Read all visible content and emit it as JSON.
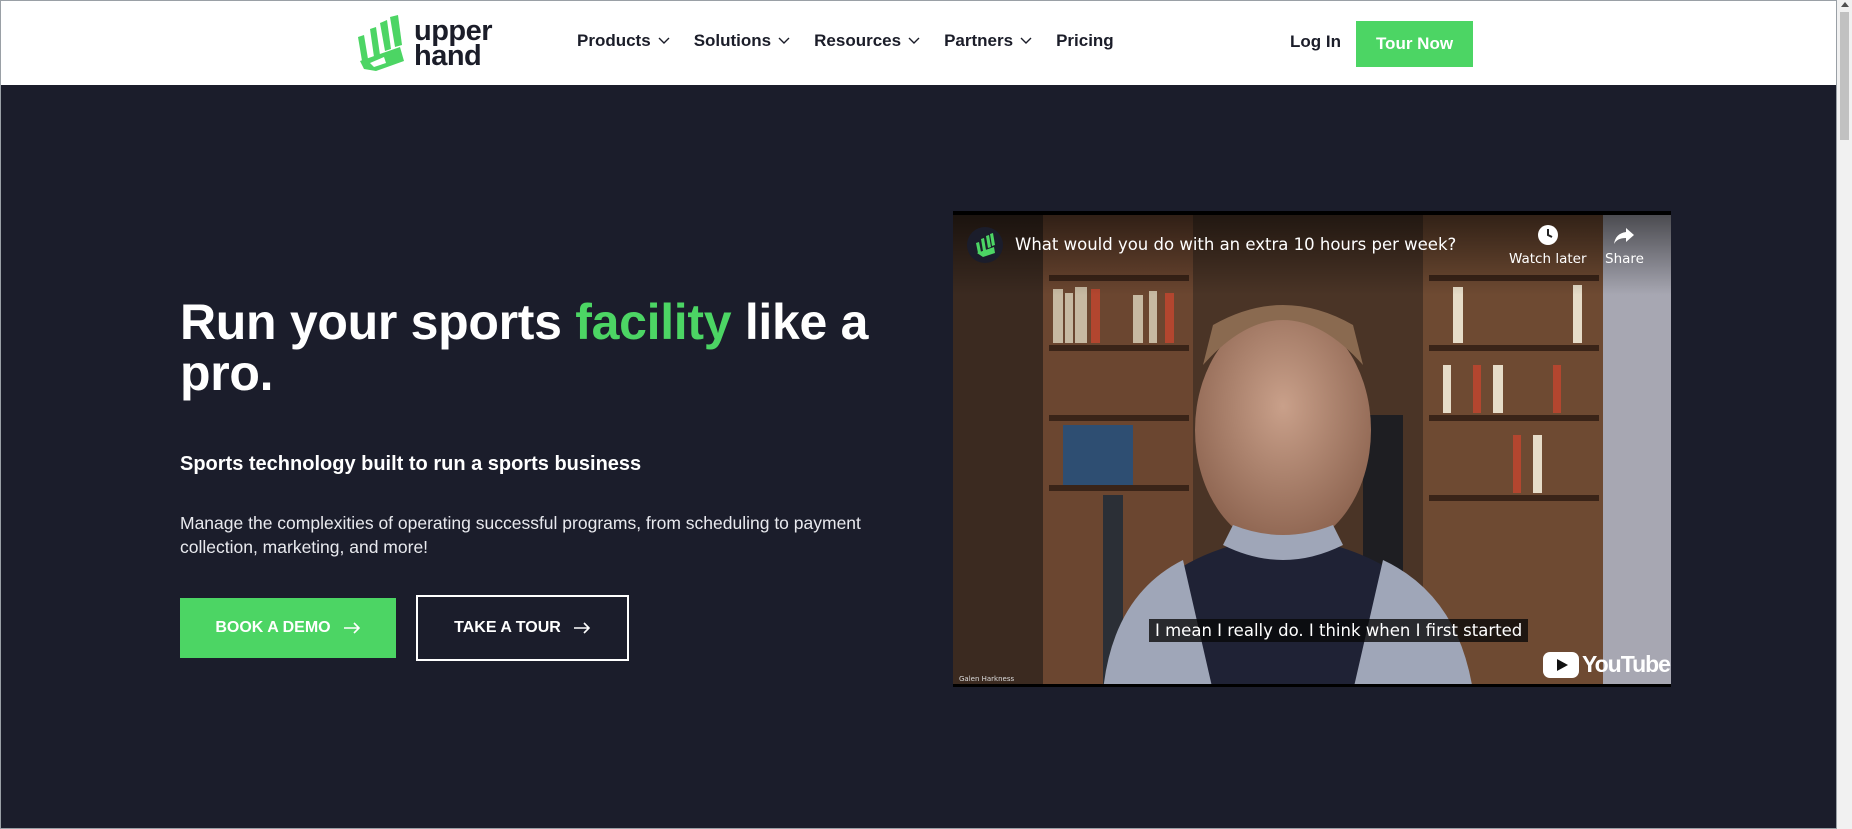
{
  "brand": {
    "name_line1": "upper",
    "name_line2": "hand",
    "accent_color": "#4cd564",
    "dark_color": "#1b1d2b"
  },
  "nav": {
    "items": [
      {
        "label": "Products",
        "has_dropdown": true
      },
      {
        "label": "Solutions",
        "has_dropdown": true
      },
      {
        "label": "Resources",
        "has_dropdown": true
      },
      {
        "label": "Partners",
        "has_dropdown": true
      },
      {
        "label": "Pricing",
        "has_dropdown": false
      }
    ],
    "login_label": "Log In",
    "cta_label": "Tour Now"
  },
  "hero": {
    "headline_part1": "Run your sports ",
    "headline_accent": "facility",
    "headline_part2": " like a pro.",
    "subhead": "Sports technology built to run a sports business",
    "body": "Manage the complexities of operating successful programs, from scheduling to payment collection, marketing, and more!",
    "btn_demo": "BOOK A DEMO",
    "btn_tour": "TAKE A TOUR"
  },
  "video": {
    "title": "What would you do with an extra 10 hours per week?",
    "watch_later": "Watch later",
    "share": "Share",
    "caption": "I mean I really do. I think when I first started",
    "platform": "YouTube",
    "speaker_tag": "Galen Harkness",
    "icons": [
      "clock-icon",
      "share-icon",
      "play-icon"
    ]
  }
}
